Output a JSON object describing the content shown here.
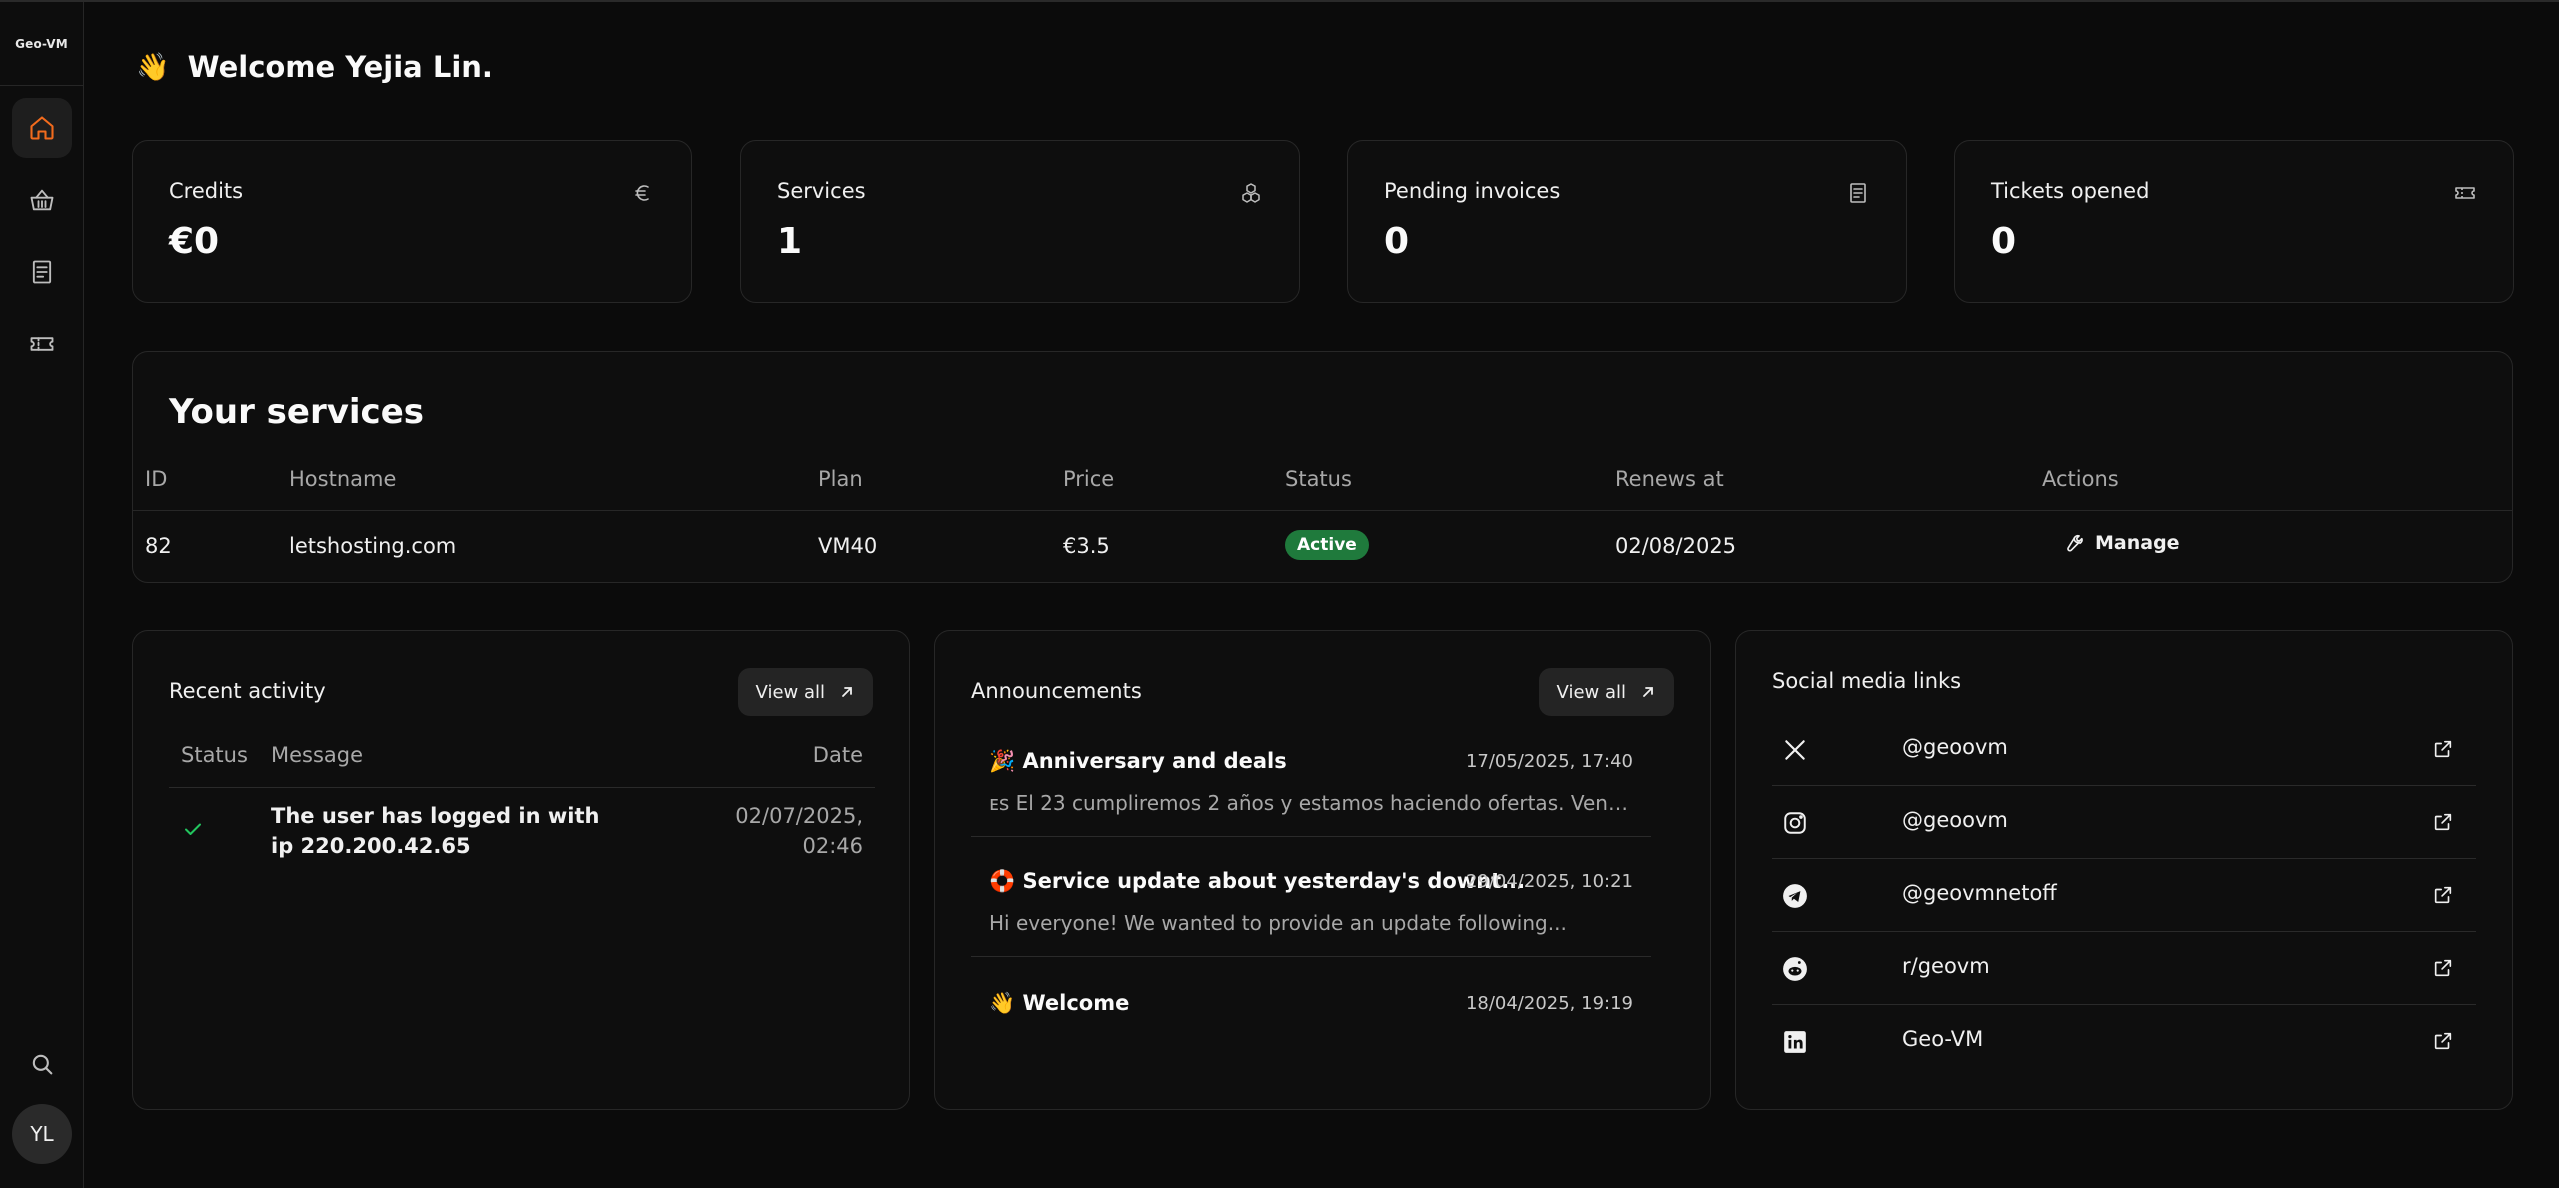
{
  "brand": {
    "logo_text": "Geo-VM"
  },
  "sidebar": {
    "items": [
      {
        "name": "home",
        "icon": "home-icon",
        "active": true
      },
      {
        "name": "store",
        "icon": "basket-icon",
        "active": false
      },
      {
        "name": "invoices",
        "icon": "receipt-icon",
        "active": false
      },
      {
        "name": "tickets",
        "icon": "ticket-icon",
        "active": false
      }
    ],
    "search_icon": "search-icon",
    "avatar_initials": "YL"
  },
  "header": {
    "greeting_emoji": "👋",
    "title": "Welcome Yejia Lin."
  },
  "stats": [
    {
      "label": "Credits",
      "value": "€0",
      "icon": "euro-icon"
    },
    {
      "label": "Services",
      "value": "1",
      "icon": "cubes-icon"
    },
    {
      "label": "Pending invoices",
      "value": "0",
      "icon": "receipt-icon"
    },
    {
      "label": "Tickets opened",
      "value": "0",
      "icon": "ticket-icon"
    }
  ],
  "services": {
    "title": "Your services",
    "columns": [
      "ID",
      "Hostname",
      "Plan",
      "Price",
      "Status",
      "Renews at",
      "Actions"
    ],
    "rows": [
      {
        "id": "82",
        "hostname": "letshosting.com",
        "plan": "VM40",
        "price": "€3.5",
        "status": "Active",
        "renews_at": "02/08/2025",
        "action": "Manage"
      }
    ]
  },
  "recent_activity": {
    "title": "Recent activity",
    "view_all": "View all",
    "columns": [
      "Status",
      "Message",
      "Date"
    ],
    "rows": [
      {
        "status": "success",
        "message": "The user has logged in with ip 220.200.42.65",
        "date_line1": "02/07/2025,",
        "date_line2": "02:46"
      }
    ]
  },
  "announcements": {
    "title": "Announcements",
    "view_all": "View all",
    "items": [
      {
        "emoji": "🎉",
        "title": "Anniversary and deals",
        "date": "17/05/2025, 17:40",
        "excerpt": "ᴇs El 23 cumpliremos 2 años y estamos haciendo ofertas. Ven co..."
      },
      {
        "emoji": "🛟",
        "title": "Service update about yesterday's downt...",
        "date": "29/04/2025, 10:21",
        "excerpt": "Hi everyone! We wanted to provide an update following..."
      },
      {
        "emoji": "👋",
        "title": "Welcome",
        "date": "18/04/2025, 19:19",
        "excerpt": ""
      }
    ]
  },
  "social": {
    "title": "Social media links",
    "items": [
      {
        "platform": "x",
        "icon": "x-icon",
        "handle": "@geoovm"
      },
      {
        "platform": "instagram",
        "icon": "instagram-icon",
        "handle": "@geoovm"
      },
      {
        "platform": "telegram",
        "icon": "telegram-icon",
        "handle": "@geovmnetoff"
      },
      {
        "platform": "reddit",
        "icon": "reddit-icon",
        "handle": "r/geovm"
      },
      {
        "platform": "linkedin",
        "icon": "linkedin-icon",
        "handle": "Geo-VM"
      }
    ]
  },
  "colors": {
    "accent": "#f26b1d",
    "active_badge": "#1f7a3c",
    "check": "#22c55e",
    "background": "#0b0b0b"
  }
}
